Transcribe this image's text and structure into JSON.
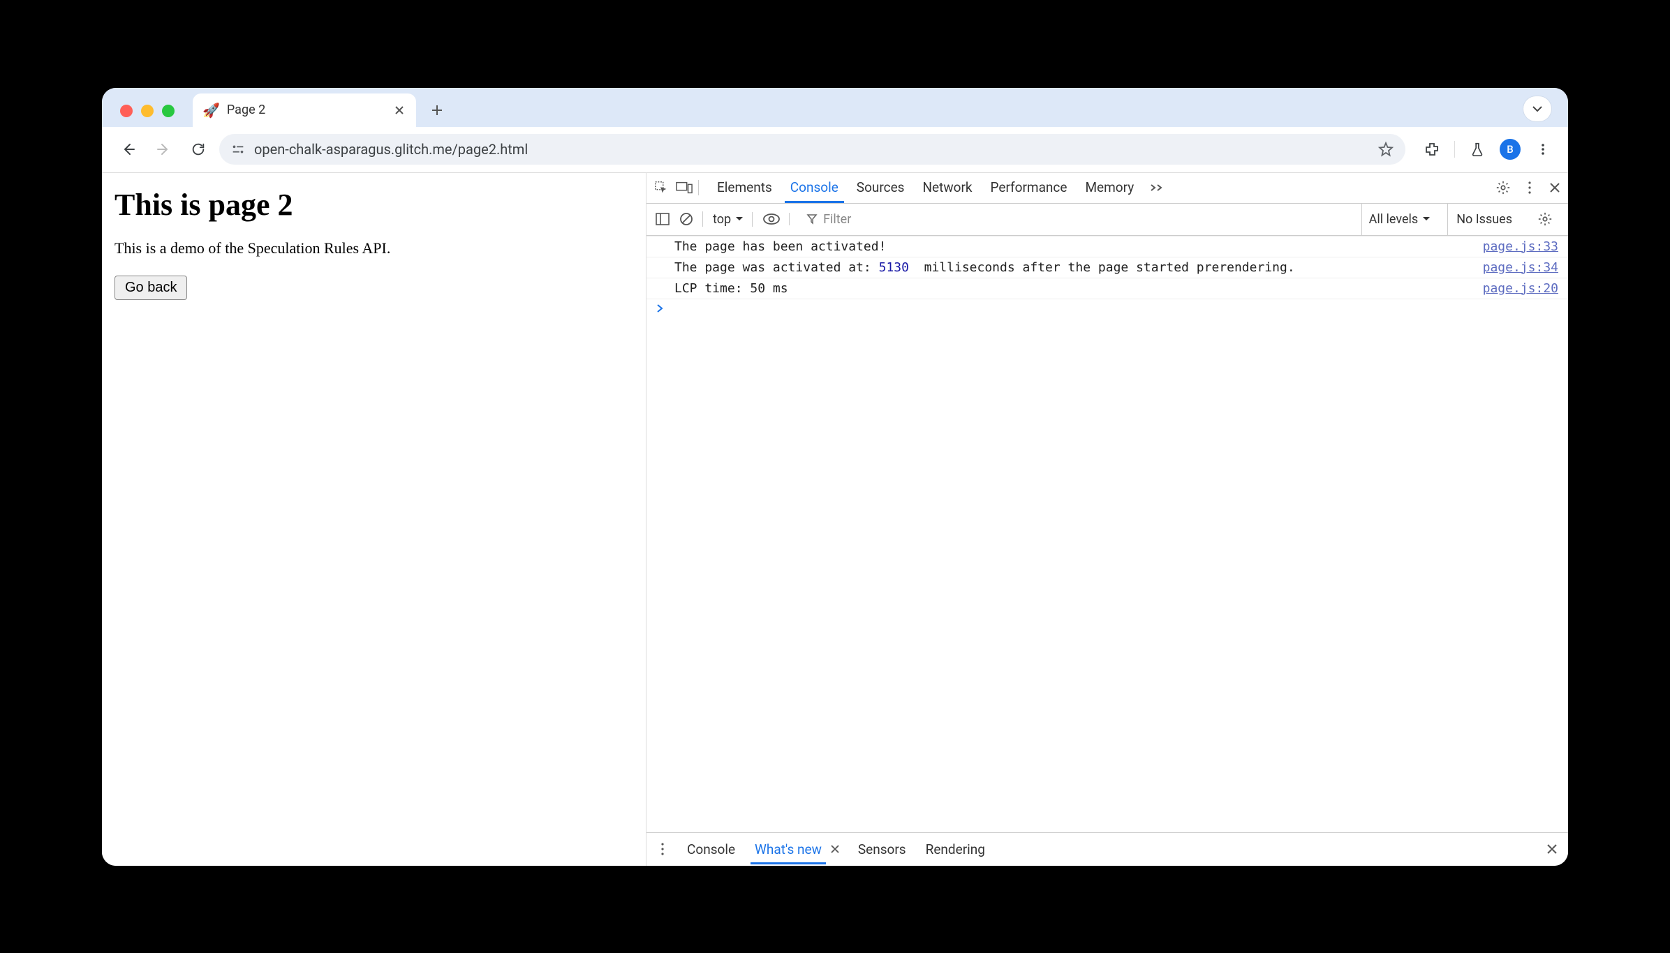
{
  "browser": {
    "tab": {
      "favicon": "🚀",
      "title": "Page 2"
    },
    "url": "open-chalk-asparagus.glitch.me/page2.html",
    "avatar_letter": "B"
  },
  "page": {
    "heading": "This is page 2",
    "paragraph": "This is a demo of the Speculation Rules API.",
    "button": "Go back"
  },
  "devtools": {
    "tabs": [
      "Elements",
      "Console",
      "Sources",
      "Network",
      "Performance",
      "Memory"
    ],
    "active_tab": "Console",
    "console_toolbar": {
      "context": "top",
      "filter_placeholder": "Filter",
      "levels_label": "All levels",
      "issues_label": "No Issues"
    },
    "messages": [
      {
        "text": "The page has been activated!",
        "src": "page.js:33"
      },
      {
        "text_a": "The page was activated at: ",
        "num": "5130",
        "text_b": "  milliseconds after the page started prerendering.",
        "src": "page.js:34"
      },
      {
        "text": "LCP time: 50 ms",
        "src": "page.js:20"
      }
    ],
    "drawer_tabs": [
      "Console",
      "What's new",
      "Sensors",
      "Rendering"
    ],
    "drawer_active": "What's new"
  }
}
